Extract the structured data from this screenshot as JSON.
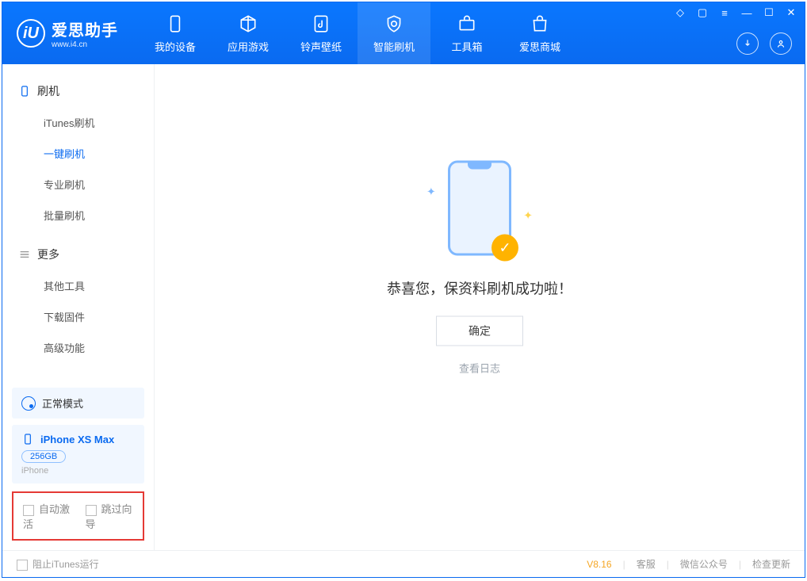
{
  "app": {
    "title": "爱思助手",
    "url": "www.i4.cn"
  },
  "nav": {
    "items": [
      {
        "label": "我的设备"
      },
      {
        "label": "应用游戏"
      },
      {
        "label": "铃声壁纸"
      },
      {
        "label": "智能刷机"
      },
      {
        "label": "工具箱"
      },
      {
        "label": "爱思商城"
      }
    ],
    "active_index": 3
  },
  "sidebar": {
    "group1_label": "刷机",
    "group1_items": [
      {
        "label": "iTunes刷机"
      },
      {
        "label": "一键刷机"
      },
      {
        "label": "专业刷机"
      },
      {
        "label": "批量刷机"
      }
    ],
    "group1_active_index": 1,
    "group2_label": "更多",
    "group2_items": [
      {
        "label": "其他工具"
      },
      {
        "label": "下载固件"
      },
      {
        "label": "高级功能"
      }
    ],
    "mode_label": "正常模式",
    "device_name": "iPhone XS Max",
    "device_capacity": "256GB",
    "device_type": "iPhone",
    "options": {
      "auto_activate": "自动激活",
      "skip_guide": "跳过向导"
    }
  },
  "main": {
    "success_message": "恭喜您，保资料刷机成功啦！",
    "confirm_label": "确定",
    "view_logs": "查看日志"
  },
  "statusbar": {
    "block_itunes": "阻止iTunes运行",
    "version": "V8.16",
    "service": "客服",
    "wechat": "微信公众号",
    "update": "检查更新"
  }
}
